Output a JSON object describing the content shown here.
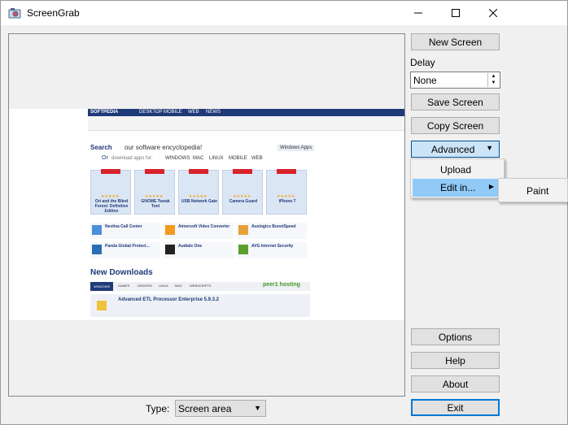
{
  "window": {
    "title": "ScreenGrab",
    "controls": {
      "minimize": "—",
      "maximize": "☐",
      "close": "✕"
    }
  },
  "sidebar": {
    "new_screen": "New Screen",
    "delay_label": "Delay",
    "delay_value": "None",
    "save_screen": "Save Screen",
    "copy_screen": "Copy Screen",
    "advanced": "Advanced",
    "options": "Options",
    "help": "Help",
    "about": "About",
    "exit": "Exit"
  },
  "advanced_menu": {
    "items": [
      "Upload",
      "Edit in..."
    ],
    "submenu": [
      "Paint"
    ]
  },
  "type": {
    "label": "Type:",
    "value": "Screen area"
  },
  "colors": {
    "accent": "#0078d7",
    "menu_highlight": "#91c9f7",
    "site_navy": "#1f3a78"
  },
  "screenshot": {
    "logo": "SOFTPEDIA",
    "nav": [
      "DESKTOP",
      "MOBILE",
      "WEB",
      "NEWS"
    ],
    "search_label": "Search",
    "search_value": "our software encyclopedia!",
    "or_text": "Or",
    "browse_text": "download apps for:",
    "platforms": [
      "WINDOWS",
      "MAC",
      "LINUX",
      "MOBILE",
      "WEB"
    ],
    "search_scope": "Windows Apps",
    "cards": [
      "Ori and the Blind Forest: Definitive Edition",
      "GNOME Tweak Tool",
      "USB Network Gate",
      "Camera Guard",
      "iPhone 7"
    ],
    "minis": [
      "Nextiva Call Center",
      "Aimersoft Video Converter",
      "Auslogics BoostSpeed",
      "Panda Global Protect...",
      "Audials One",
      "AVG Internet Security"
    ],
    "new_downloads_title": "New Downloads",
    "nd_tabs": [
      "WINDOWS",
      "GAMES",
      "DRIVERS",
      "LINUX",
      "MAC",
      "WEBSCRIPTS"
    ],
    "nd_brand": "peer1 hosting",
    "nd_item": "Advanced ETL Processor Enterprise 5.9.3.2"
  }
}
